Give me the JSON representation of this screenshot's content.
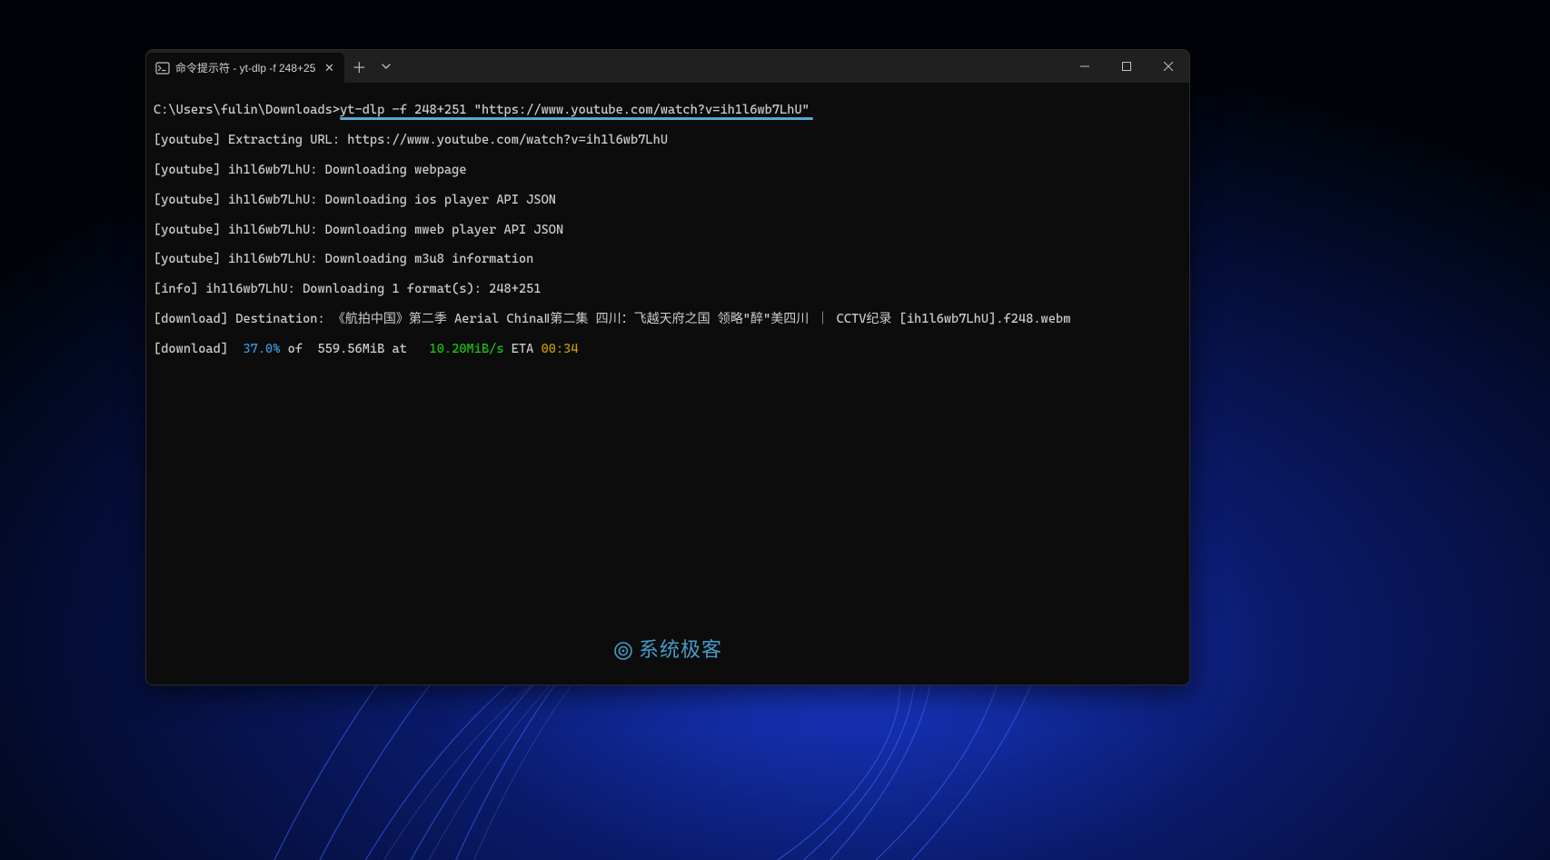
{
  "titlebar": {
    "tab_title": "命令提示符 - yt-dlp  -f 248+25",
    "close_glyph": "✕",
    "newtab_glyph": "＋",
    "dropdown_glyph": "⌄"
  },
  "terminal": {
    "prompt_prefix": "C:\\Users\\fulin\\Downloads>",
    "command": "yt-dlp -f 248+251 \"https://www.youtube.com/watch?v=ih1l6wb7LhU\"",
    "lines": {
      "l2": "[youtube] Extracting URL: https://www.youtube.com/watch?v=ih1l6wb7LhU",
      "l3": "[youtube] ih1l6wb7LhU: Downloading webpage",
      "l4": "[youtube] ih1l6wb7LhU: Downloading ios player API JSON",
      "l5": "[youtube] ih1l6wb7LhU: Downloading mweb player API JSON",
      "l6": "[youtube] ih1l6wb7LhU: Downloading m3u8 information",
      "l7": "[info] ih1l6wb7LhU: Downloading 1 format(s): 248+251",
      "l8": "[download] Destination: 《航拍中国》第二季 Aerial ChinaⅡ第二集 四川：飞越天府之国 领略\"醉\"美四川 ｜ CCTV纪录 [ih1l6wb7LhU].f248.webm"
    },
    "progress": {
      "prefix": "[download]  ",
      "percent": "37.0%",
      "of_text": " of  559.56MiB at   ",
      "speed": "10.20MiB/s",
      "eta_label": " ETA ",
      "eta": "00:34"
    }
  },
  "watermark": {
    "text": "系统极客"
  }
}
